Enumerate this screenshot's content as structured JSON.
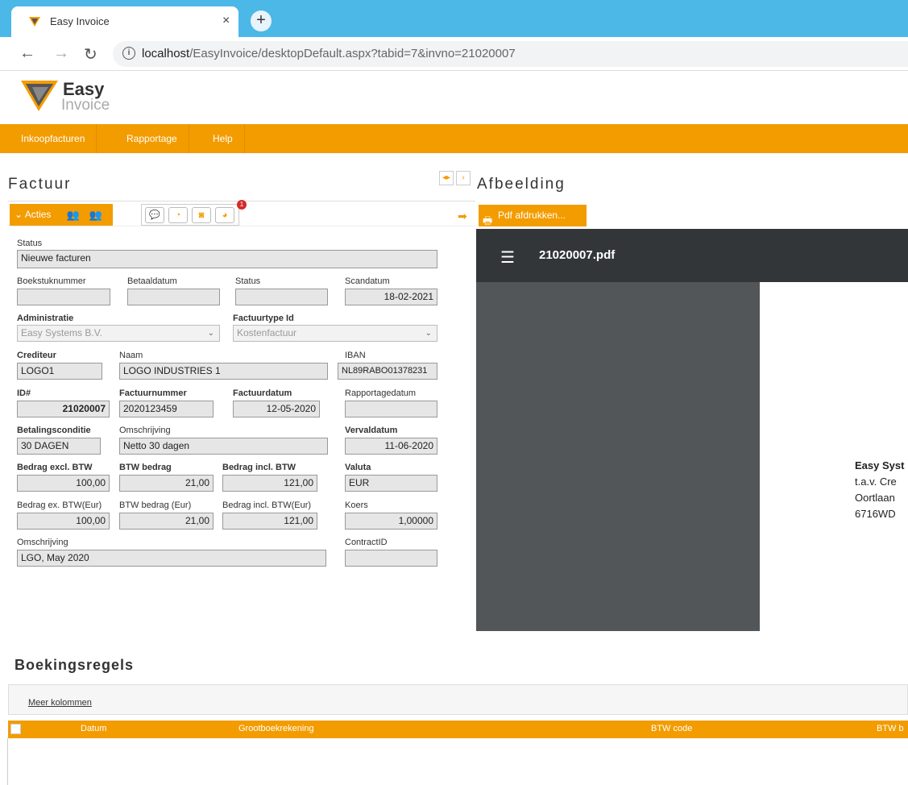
{
  "browser": {
    "tab_title": "Easy Invoice",
    "tab_close": "×",
    "new_tab": "+",
    "url_host": "localhost",
    "url_path": "/EasyInvoice/desktopDefault.aspx?tabid=7&invno=21020007"
  },
  "logo": {
    "word1": "Easy",
    "word2": "Invoice"
  },
  "menu": [
    "Inkoopfacturen",
    "Rapportage",
    "Help"
  ],
  "factuur": {
    "title": "Factuur",
    "acties_label": "Acties",
    "badge_count": "1",
    "fields": {
      "status_label": "Status",
      "status_value": "Nieuwe facturen",
      "boekstuk_label": "Boekstuknummer",
      "boekstuk_value": "",
      "betaaldatum_label": "Betaaldatum",
      "betaaldatum_value": "",
      "status2_label": "Status",
      "status2_value": "",
      "scandatum_label": "Scandatum",
      "scandatum_value": "18-02-2021",
      "administratie_label": "Administratie",
      "administratie_value": "Easy Systems B.V.",
      "factuurtype_label": "Factuurtype Id",
      "factuurtype_value": "Kostenfactuur",
      "crediteur_label": "Crediteur",
      "crediteur_value": "LOGO1",
      "naam_label": "Naam",
      "naam_value": "LOGO INDUSTRIES 1",
      "iban_label": "IBAN",
      "iban_value": "NL89RABO01378231",
      "id_label": "ID#",
      "id_value": "21020007",
      "factuurnummer_label": "Factuurnummer",
      "factuurnummer_value": "2020123459",
      "factuurdatum_label": "Factuurdatum",
      "factuurdatum_value": "12-05-2020",
      "rapportagedatum_label": "Rapportagedatum",
      "rapportagedatum_value": "",
      "betalingsconditie_label": "Betalingsconditie",
      "betalingsconditie_value": "30 DAGEN",
      "omschrijving1_label": "Omschrijving",
      "omschrijving1_value": "Netto 30 dagen",
      "vervaldatum_label": "Vervaldatum",
      "vervaldatum_value": "11-06-2020",
      "bedrag_excl_label": "Bedrag excl. BTW",
      "bedrag_excl_value": "100,00",
      "btw_bedrag_label": "BTW bedrag",
      "btw_bedrag_value": "21,00",
      "bedrag_incl_label": "Bedrag incl. BTW",
      "bedrag_incl_value": "121,00",
      "valuta_label": "Valuta",
      "valuta_value": "EUR",
      "bedrag_ex_eur_label": "Bedrag ex. BTW(Eur)",
      "bedrag_ex_eur_value": "100,00",
      "btw_bedrag_eur_label": "BTW bedrag (Eur)",
      "btw_bedrag_eur_value": "21,00",
      "bedrag_incl_eur_label": "Bedrag incl. BTW(Eur)",
      "bedrag_incl_eur_value": "121,00",
      "koers_label": "Koers",
      "koers_value": "1,00000",
      "omschrijving2_label": "Omschrijving",
      "omschrijving2_value": "LGO, May 2020",
      "contract_label": "ContractID",
      "contract_value": ""
    }
  },
  "afbeelding": {
    "title": "Afbeelding",
    "pdf_button": "Pdf afdrukken...",
    "viewer_title": "21020007.pdf",
    "address_lines": [
      "Easy Syst",
      "t.a.v. Cre",
      "Oortlaan",
      "6716WD"
    ]
  },
  "boekingsregels": {
    "title": "Boekingsregels",
    "meer_kolommen": "Meer kolommen",
    "columns": [
      "Datum",
      "Grootboekrekening",
      "BTW code",
      "BTW b"
    ]
  },
  "colors": {
    "accent": "#f39c00",
    "browser_blue": "#4bb8e8",
    "viewer_dark": "#323639"
  }
}
